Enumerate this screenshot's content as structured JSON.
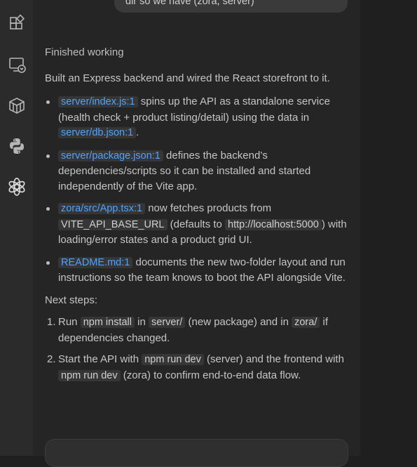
{
  "user_message": "dir so we have (zora, server)",
  "status": "Finished working",
  "intro": "Built an Express backend and wired the React storefront to it.",
  "items": [
    {
      "link": "server/index.js:1",
      "t1": " spins up the API as a standalone service (health check + product listing/detail) using the data in ",
      "link2": "server/db.json:1",
      "t2": "."
    },
    {
      "link": "server/package.json:1",
      "t1": " defines the backend’s dependencies/scripts so it can be installed and started independently of the Vite app."
    },
    {
      "link": "zora/src/App.tsx:1",
      "t1": " now fetches products from ",
      "code1": "VITE_API_BASE_URL",
      "t2": " (defaults to ",
      "code2": "http://localhost:5000",
      "t3": ") with loading/error states and a product grid UI."
    },
    {
      "link": "README.md:1",
      "t1": " documents the new two-folder layout and run instructions so the team knows to boot the API alongside Vite."
    }
  ],
  "next_steps_label": "Next steps:",
  "steps": [
    {
      "num": "1.",
      "t1": "Run ",
      "code1": "npm install",
      "t2": " in ",
      "code2": "server/",
      "t3": " (new package) and in ",
      "code3": "zora/",
      "t4": " if dependencies changed."
    },
    {
      "num": "2.",
      "t1": "Start the API with ",
      "code1": "npm run dev",
      "t2": " (server) and the frontend with ",
      "code2": "npm run dev",
      "t3": " (zora) to confirm end-to-end data flow."
    }
  ],
  "activity_icons": [
    "extensions-icon",
    "remote-explorer-icon",
    "package-icon",
    "python-icon",
    "openai-icon"
  ],
  "colors": {
    "link": "#4da3ff",
    "panel_bg": "#252525",
    "sidebar_bg": "#2b2b2b",
    "code_bg": "#363636"
  }
}
